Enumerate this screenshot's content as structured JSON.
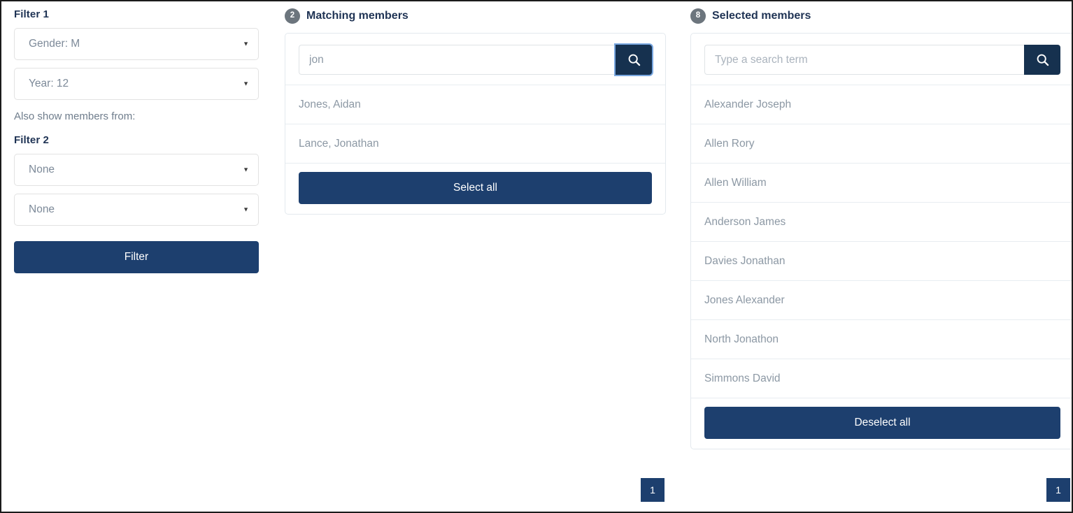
{
  "filters": {
    "filter1": {
      "heading": "Filter 1",
      "selects": [
        {
          "value": "Gender: M",
          "caret": "▼"
        },
        {
          "value": "Year: 12",
          "caret": "▼"
        }
      ]
    },
    "also_show_label": "Also show members from:",
    "filter2": {
      "heading": "Filter 2",
      "selects": [
        {
          "value": "None",
          "caret": "▼"
        },
        {
          "value": "None",
          "caret": "▼"
        }
      ]
    },
    "filter_button_label": "Filter"
  },
  "matching": {
    "badge_count": "2",
    "title": "Matching members",
    "search": {
      "value": "jon",
      "placeholder": "Type a search term",
      "icon": "search-icon"
    },
    "items": [
      "Jones, Aidan",
      "Lance, Jonathan"
    ],
    "select_all_label": "Select all",
    "pagination": {
      "current_page": "1"
    }
  },
  "selected": {
    "badge_count": "8",
    "title": "Selected members",
    "search": {
      "value": "",
      "placeholder": "Type a search term",
      "icon": "search-icon"
    },
    "items": [
      "Alexander Joseph",
      "Allen Rory",
      "Allen William",
      "Anderson James",
      "Davies Jonathan",
      "Jones Alexander",
      "North Jonathon",
      "Simmons David"
    ],
    "deselect_all_label": "Deselect all",
    "pagination": {
      "current_page": "1"
    }
  },
  "colors": {
    "primary": "#1d3f6e",
    "search_button": "#16314f",
    "badge": "#6c757d",
    "heading": "#1f3354",
    "muted_text": "#8c98a4"
  }
}
